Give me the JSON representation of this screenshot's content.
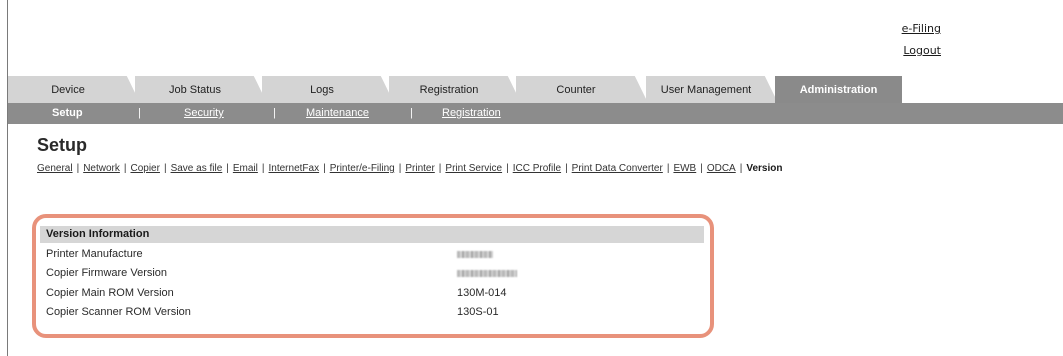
{
  "top_links": {
    "efiling": "e-Filing",
    "logout": "Logout"
  },
  "tabs": [
    {
      "label": "Device"
    },
    {
      "label": "Job Status"
    },
    {
      "label": "Logs"
    },
    {
      "label": "Registration"
    },
    {
      "label": "Counter"
    },
    {
      "label": "User Management"
    },
    {
      "label": "Administration"
    }
  ],
  "subnav": {
    "items": [
      {
        "label": "Setup"
      },
      {
        "label": "Security"
      },
      {
        "label": "Maintenance"
      },
      {
        "label": "Registration"
      }
    ],
    "separator": "|"
  },
  "page_title": "Setup",
  "sublinks": {
    "items": [
      {
        "label": "General"
      },
      {
        "label": "Network"
      },
      {
        "label": "Copier"
      },
      {
        "label": "Save as file"
      },
      {
        "label": "Email"
      },
      {
        "label": "InternetFax"
      },
      {
        "label": "Printer/e-Filing"
      },
      {
        "label": "Printer"
      },
      {
        "label": "Print Service"
      },
      {
        "label": "ICC Profile"
      },
      {
        "label": "Print Data Converter"
      },
      {
        "label": "EWB"
      },
      {
        "label": "ODCA"
      },
      {
        "label": "Version"
      }
    ],
    "separator": "|"
  },
  "version_info": {
    "header": "Version Information",
    "rows": [
      {
        "label": "Printer Manufacture",
        "value": ""
      },
      {
        "label": "Copier Firmware Version",
        "value": ""
      },
      {
        "label": "Copier Main ROM Version",
        "value": "130M-014"
      },
      {
        "label": "Copier Scanner ROM Version",
        "value": "130S-01"
      }
    ]
  },
  "colors": {
    "tab_inactive": "#d4d4d4",
    "tab_active": "#8a8a8a",
    "subnav_bg": "#8c8c8c",
    "highlight_border": "#e8927b",
    "section_header_bg": "#d6d6d6"
  }
}
